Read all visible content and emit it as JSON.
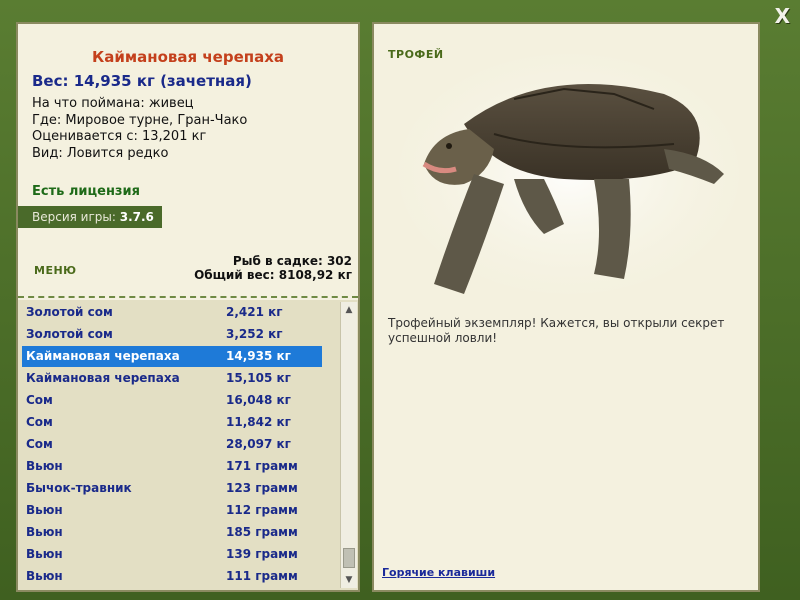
{
  "window": {
    "close_label": "X"
  },
  "fish": {
    "title": "Каймановая черепаха",
    "weight": "Вес: 14,935 кг (зачетная)",
    "info": [
      "На что поймана: живец",
      "Где: Мировое турне, Гран-Чако",
      "Оценивается с: 13,201 кг",
      "Вид: Ловится редко"
    ]
  },
  "license": "Есть лицензия",
  "version": {
    "label": "Версия игры: ",
    "value": "3.7.6"
  },
  "menu_label": "МЕНЮ",
  "stats": {
    "fish_count": "Рыб в садке: 302",
    "total_weight": "Общий вес: 8108,92 кг"
  },
  "catch_list": [
    {
      "name": "Золотой сом",
      "weight": "2,421 кг"
    },
    {
      "name": "Золотой сом",
      "weight": "3,252 кг"
    },
    {
      "name": "Каймановая черепаха",
      "weight": "14,935 кг",
      "selected": true
    },
    {
      "name": "Каймановая черепаха",
      "weight": "15,105 кг"
    },
    {
      "name": "Сом",
      "weight": "16,048 кг"
    },
    {
      "name": "Сом",
      "weight": "11,842 кг"
    },
    {
      "name": "Сом",
      "weight": "28,097 кг"
    },
    {
      "name": "Вьюн",
      "weight": "171 грамм"
    },
    {
      "name": "Бычок-травник",
      "weight": "123 грамм"
    },
    {
      "name": "Вьюн",
      "weight": "112 грамм"
    },
    {
      "name": "Вьюн",
      "weight": "185 грамм"
    },
    {
      "name": "Вьюн",
      "weight": "139 грамм"
    },
    {
      "name": "Вьюн",
      "weight": "111 грамм"
    }
  ],
  "trophy_label": "ТРОФЕЙ",
  "description": "Трофейный экземпляр! Кажется, вы открыли секрет успешной ловли!",
  "hotkeys_label": "Горячие клавиши",
  "colors": {
    "frame": "#4a6a28",
    "panel": "#f4f1df",
    "selection": "#1e7ad8"
  }
}
